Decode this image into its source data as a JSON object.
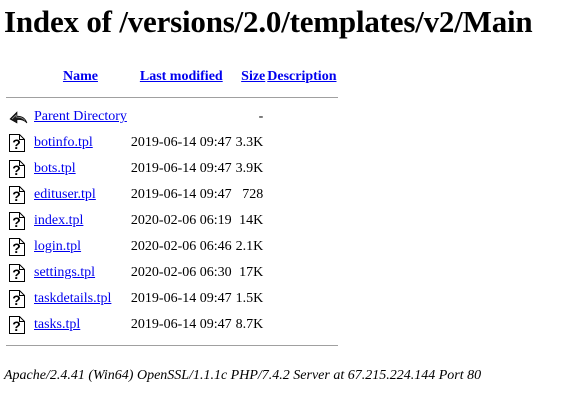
{
  "page": {
    "heading": "Index of /versions/2.0/templates/v2/Main"
  },
  "columns": {
    "name": "Name",
    "last_modified": "Last modified",
    "size": "Size",
    "description": "Description"
  },
  "parent": {
    "label": "Parent Directory",
    "size": "-",
    "icon": "back-arrow-icon"
  },
  "files": [
    {
      "name": "botinfo.tpl",
      "modified": "2019-06-14 09:47",
      "size": "3.3K",
      "icon": "unknown-file-icon"
    },
    {
      "name": "bots.tpl",
      "modified": "2019-06-14 09:47",
      "size": "3.9K",
      "icon": "unknown-file-icon"
    },
    {
      "name": "edituser.tpl",
      "modified": "2019-06-14 09:47",
      "size": "728",
      "icon": "unknown-file-icon"
    },
    {
      "name": "index.tpl",
      "modified": "2020-02-06 06:19",
      "size": "14K",
      "icon": "unknown-file-icon"
    },
    {
      "name": "login.tpl",
      "modified": "2020-02-06 06:46",
      "size": "2.1K",
      "icon": "unknown-file-icon"
    },
    {
      "name": "settings.tpl",
      "modified": "2020-02-06 06:30",
      "size": "17K",
      "icon": "unknown-file-icon"
    },
    {
      "name": "taskdetails.tpl",
      "modified": "2019-06-14 09:47",
      "size": "1.5K",
      "icon": "unknown-file-icon"
    },
    {
      "name": "tasks.tpl",
      "modified": "2019-06-14 09:47",
      "size": "8.7K",
      "icon": "unknown-file-icon"
    }
  ],
  "footer": {
    "server_signature": "Apache/2.4.41 (Win64) OpenSSL/1.1.1c PHP/7.4.2 Server at 67.215.224.144 Port 80"
  },
  "colors": {
    "link": "#0000ee",
    "rule": "#a0a0a0",
    "background": "#ffffff"
  }
}
